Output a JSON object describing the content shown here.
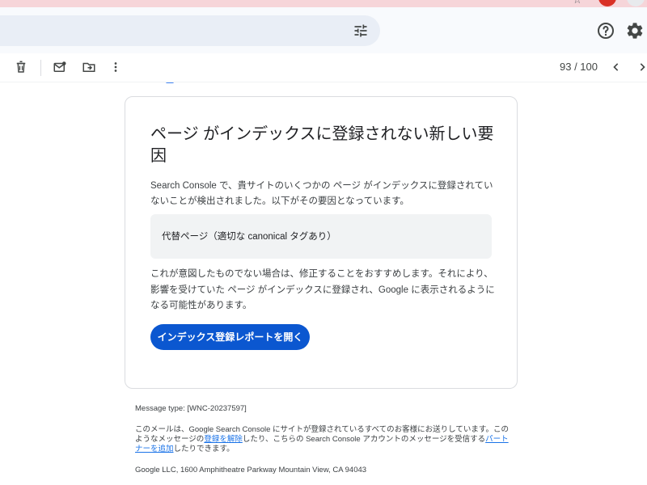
{
  "toolbar": {
    "page_count": "93 / 100"
  },
  "email": {
    "title": "ページ がインデックスに登録されない新しい要因",
    "intro": "Search Console で、貴サイトのいくつかの ページ がインデックスに登録されていないことが検出されました。以下がその要因となっています。",
    "reason": "代替ページ（適切な canonical タグあり）",
    "advice": "これが意図したものでない場合は、修正することをおすすめします。それにより、影響を受けていた ページ がインデックスに登録され、Google に表示されるようになる可能性があります。",
    "cta_label": "インデックス登録レポートを開く"
  },
  "footer": {
    "message_type": "Message type: [WNC-20237597]",
    "note_part1": "このメールは、Google Search Console にサイトが登録されているすべてのお客様にお送りしています。このようなメッセージの",
    "unsubscribe_link": "登録を解除",
    "note_part2": "したり、こちらの Search Console アカウントのメッセージを受信する",
    "add_partner_link": "パートナーを追加",
    "note_part3": "したりできます。",
    "address": "Google LLC, 1600 Amphitheatre Parkway Mountain View, CA 94043"
  },
  "colors": {
    "primary_button": "#0b57d0",
    "link": "#1a73e8",
    "reason_bg": "#f1f3f4",
    "header_bg": "#f8fafd"
  },
  "icons": {
    "delete": "trash-icon",
    "mark_unread": "mark-unread-icon",
    "move_to": "move-to-icon",
    "more": "more-vert-icon",
    "search_options": "tune-icon",
    "help": "help-icon",
    "settings": "gear-icon",
    "prev": "chevron-left-icon",
    "next": "chevron-right-icon"
  }
}
